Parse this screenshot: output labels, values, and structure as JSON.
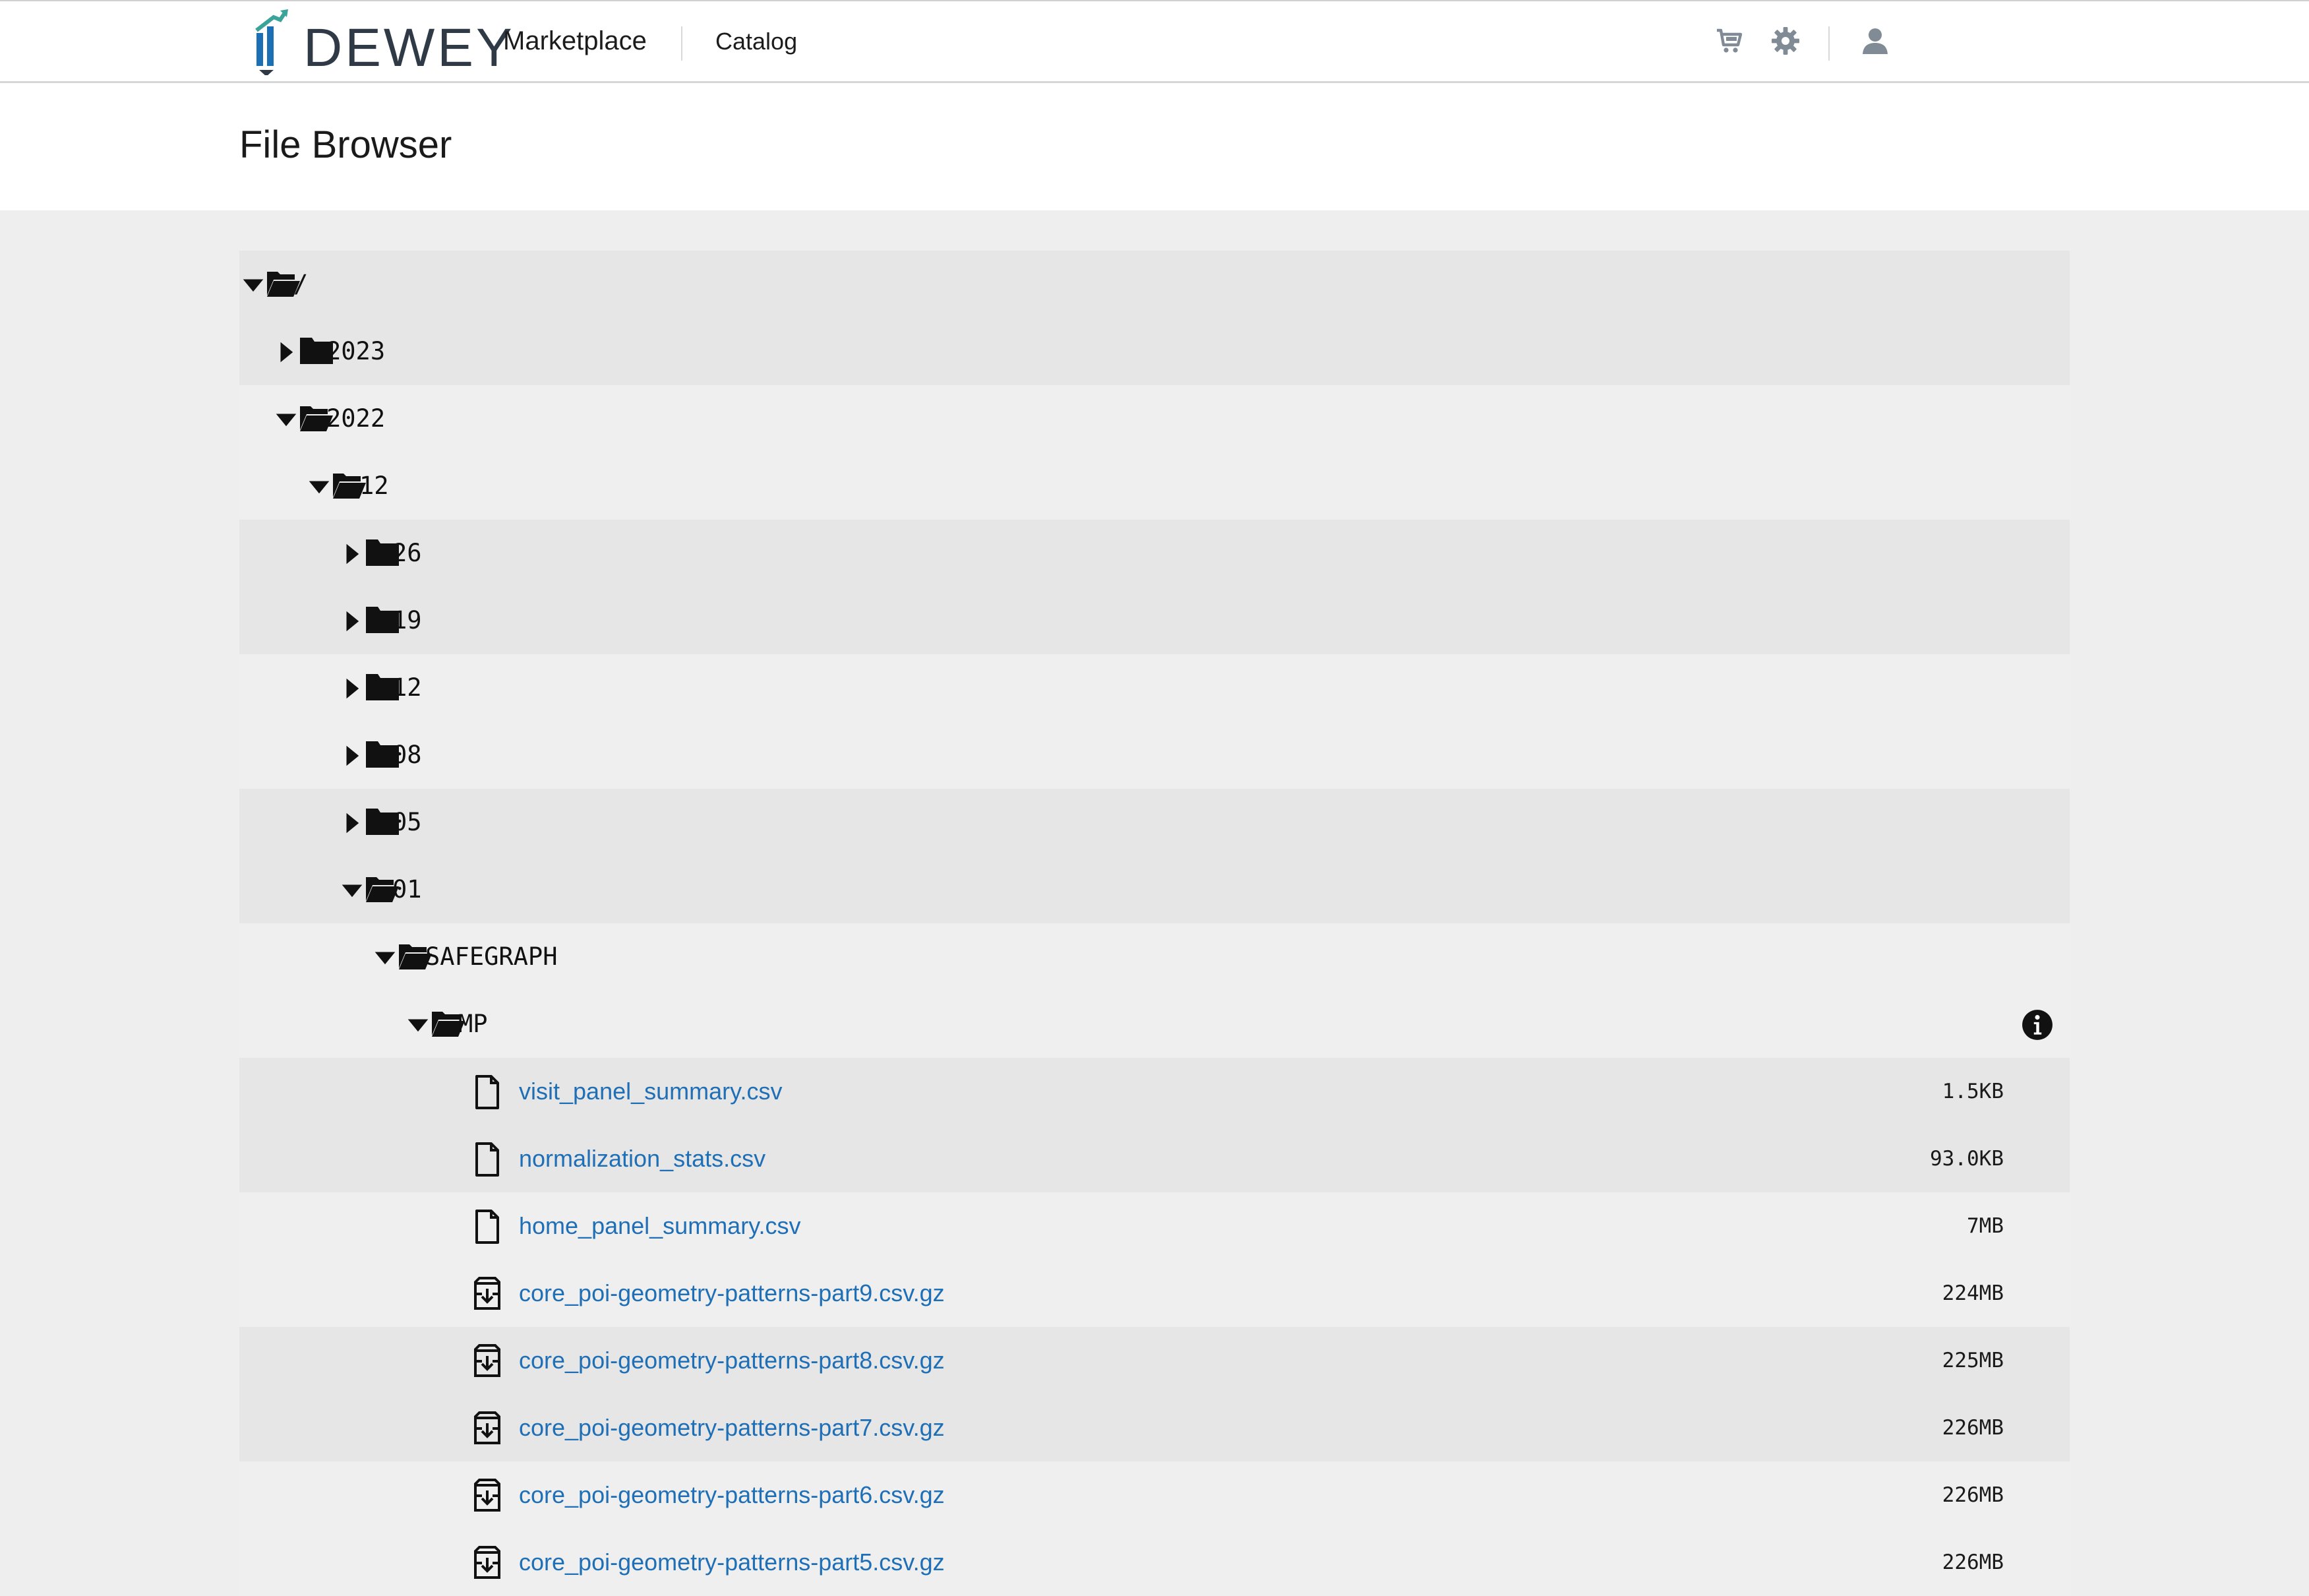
{
  "header": {
    "logo_text": "DEWEY",
    "brand_suffix": "Marketplace",
    "nav_catalog": "Catalog",
    "icons": [
      "cart-icon",
      "gear-icon",
      "user-icon"
    ],
    "colors": {
      "logo_text": "#2f3a46",
      "logo_blue": "#1a6fb5",
      "logo_teal": "#3aa39a"
    }
  },
  "page": {
    "title": "File Browser"
  },
  "tree": [
    {
      "name": "/",
      "type": "folder",
      "expanded": true,
      "depth": 0
    },
    {
      "name": "2023",
      "type": "folder",
      "expanded": false,
      "depth": 1
    },
    {
      "name": "2022",
      "type": "folder",
      "expanded": true,
      "depth": 1
    },
    {
      "name": "12",
      "type": "folder",
      "expanded": true,
      "depth": 2
    },
    {
      "name": "26",
      "type": "folder",
      "expanded": false,
      "depth": 3
    },
    {
      "name": "19",
      "type": "folder",
      "expanded": false,
      "depth": 3
    },
    {
      "name": "12",
      "type": "folder",
      "expanded": false,
      "depth": 3
    },
    {
      "name": "08",
      "type": "folder",
      "expanded": false,
      "depth": 3
    },
    {
      "name": "05",
      "type": "folder",
      "expanded": false,
      "depth": 3
    },
    {
      "name": "01",
      "type": "folder",
      "expanded": true,
      "depth": 3
    },
    {
      "name": "SAFEGRAPH",
      "type": "folder",
      "expanded": true,
      "depth": 4
    },
    {
      "name": "MP",
      "type": "folder",
      "expanded": true,
      "depth": 5,
      "info": true
    },
    {
      "name": "visit_panel_summary.csv",
      "type": "file",
      "size": "1.5KB",
      "depth": 6
    },
    {
      "name": "normalization_stats.csv",
      "type": "file",
      "size": "93.0KB",
      "depth": 6
    },
    {
      "name": "home_panel_summary.csv",
      "type": "file",
      "size": "7MB",
      "depth": 6
    },
    {
      "name": "core_poi-geometry-patterns-part9.csv.gz",
      "type": "archive",
      "size": "224MB",
      "depth": 6
    },
    {
      "name": "core_poi-geometry-patterns-part8.csv.gz",
      "type": "archive",
      "size": "225MB",
      "depth": 6
    },
    {
      "name": "core_poi-geometry-patterns-part7.csv.gz",
      "type": "archive",
      "size": "226MB",
      "depth": 6
    },
    {
      "name": "core_poi-geometry-patterns-part6.csv.gz",
      "type": "archive",
      "size": "226MB",
      "depth": 6
    },
    {
      "name": "core_poi-geometry-patterns-part5.csv.gz",
      "type": "archive",
      "size": "226MB",
      "depth": 6
    }
  ],
  "colors": {
    "link": "#1f6fb7",
    "row_even": "#e6e6e6",
    "row_odd": "#efefef",
    "page_bg": "#eeeeee"
  }
}
